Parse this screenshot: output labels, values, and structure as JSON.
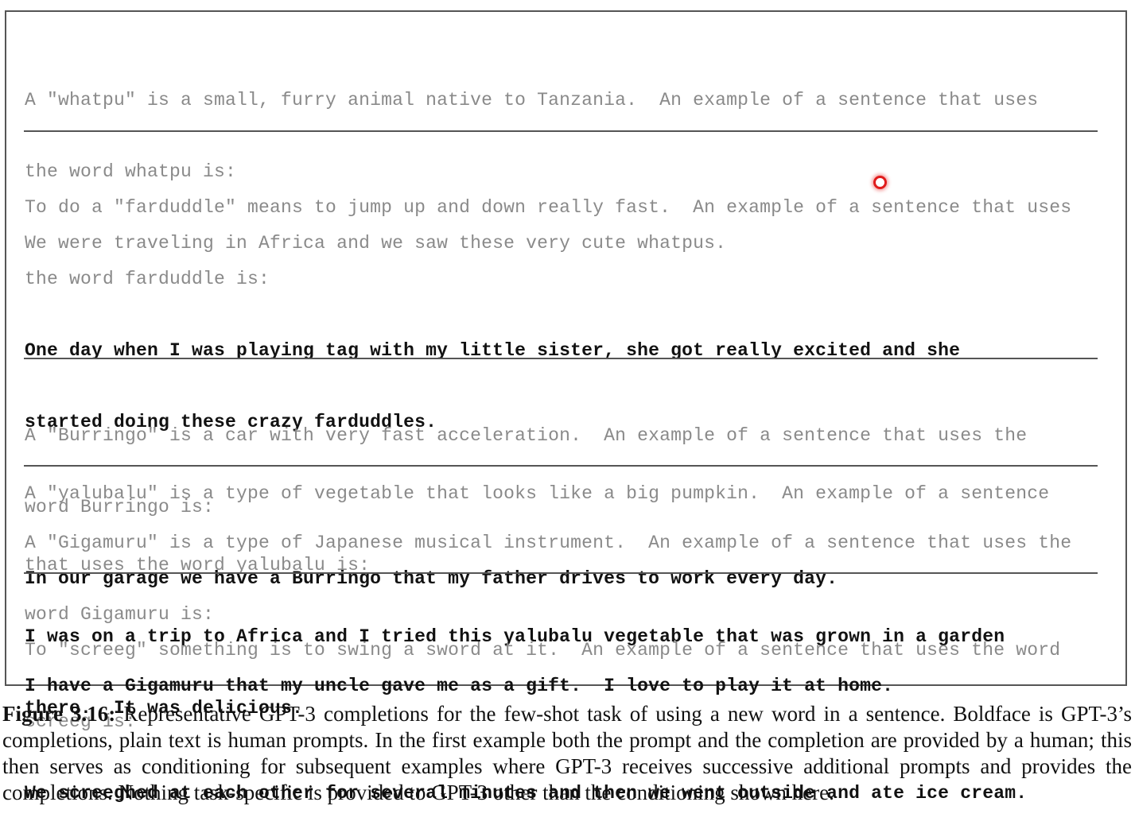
{
  "examples": [
    {
      "lines": [
        {
          "style": "prompt",
          "text": "A \"whatpu\" is a small, furry animal native to Tanzania.  An example of a sentence that uses"
        },
        {
          "style": "prompt",
          "text": "the word whatpu is:"
        },
        {
          "style": "prompt",
          "text": "We were traveling in Africa and we saw these very cute whatpus."
        }
      ]
    },
    {
      "lines": [
        {
          "style": "prompt",
          "text": "To do a \"farduddle\" means to jump up and down really fast.  An example of a sentence that uses"
        },
        {
          "style": "prompt",
          "text": "the word farduddle is:"
        },
        {
          "style": "completion",
          "text": "One day when I was playing tag with my little sister, she got really excited and she"
        },
        {
          "style": "completion",
          "text": "started doing these crazy farduddles."
        },
        {
          "style": "prompt",
          "text": "A \"yalubalu\" is a type of vegetable that looks like a big pumpkin.  An example of a sentence"
        },
        {
          "style": "prompt",
          "text": "that uses the word yalubalu is:"
        },
        {
          "style": "completion",
          "text": "I was on a trip to Africa and I tried this yalubalu vegetable that was grown in a garden"
        },
        {
          "style": "completion",
          "text": "there.  It was delicious."
        }
      ]
    },
    {
      "lines": [
        {
          "style": "prompt",
          "text": "A \"Burringo\" is a car with very fast acceleration.  An example of a sentence that uses the"
        },
        {
          "style": "prompt",
          "text": "word Burringo is:"
        },
        {
          "style": "completion",
          "text": "In our garage we have a Burringo that my father drives to work every day."
        }
      ]
    },
    {
      "lines": [
        {
          "style": "prompt",
          "text": "A \"Gigamuru\" is a type of Japanese musical instrument.  An example of a sentence that uses the"
        },
        {
          "style": "prompt",
          "text": "word Gigamuru is:"
        },
        {
          "style": "completion",
          "text": "I have a Gigamuru that my uncle gave me as a gift.  I love to play it at home."
        }
      ]
    },
    {
      "lines": [
        {
          "style": "prompt",
          "text": "To \"screeg\" something is to swing a sword at it.  An example of a sentence that uses the word"
        },
        {
          "style": "prompt",
          "text": "screeg is:"
        },
        {
          "style": "completion",
          "text": "We screeghed at each other for several minutes and then we went outside and ate ice cream."
        }
      ]
    }
  ],
  "caption": {
    "label": "Figure 3.16:",
    "text": " Representative GPT-3 completions for the few-shot task of using a new word in a sentence. Boldface is GPT-3’s completions, plain text is human prompts. In the first example both the prompt and the completion are provided by a human; this then serves as conditioning for subsequent examples where GPT-3 receives successive additional prompts and provides the completions. Nothing task-specific is provided to GPT-3 other than the conditioning shown here."
  },
  "colors": {
    "prompt_text": "#8a8a8a",
    "completion_text": "#111111",
    "border": "#555555",
    "cursor": "#e01b1b"
  }
}
